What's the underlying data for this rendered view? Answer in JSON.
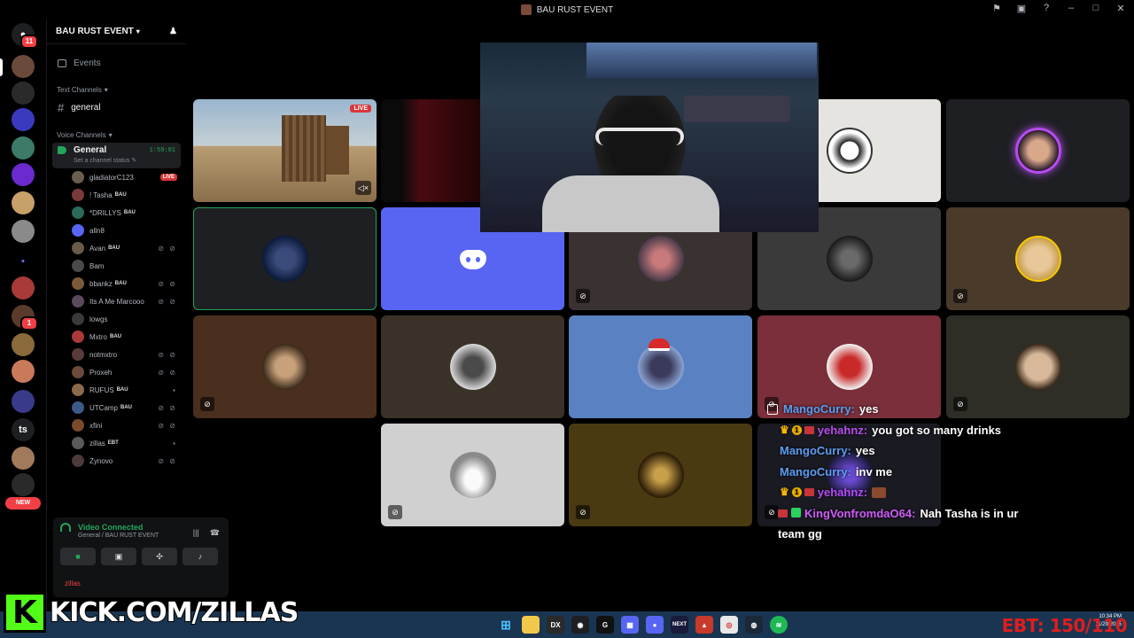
{
  "window": {
    "title": "BAU RUST EVENT"
  },
  "rail": {
    "mention_badge": "11",
    "dm_badge_1": "",
    "dm_badge_2": "1",
    "ts_label": "ts",
    "new_label": "NEW"
  },
  "server": {
    "name": "BAU RUST EVENT",
    "events_label": "Events",
    "text_category": "Text Channels",
    "text_channels": [
      {
        "name": "general"
      }
    ],
    "voice_category": "Voice Channels",
    "voice_channel": {
      "name": "General",
      "timer": "1:59:01",
      "status_placeholder": "Set a channel status"
    },
    "members": [
      {
        "name": "gladiatorC123",
        "tag": "",
        "live": "LIVE",
        "icons": "",
        "color": "#6b5e4e"
      },
      {
        "name": "! Tasha",
        "tag": "BAU",
        "live": "",
        "icons": "",
        "color": "#7a3a3a"
      },
      {
        "name": "*DRILLYS",
        "tag": "BAU",
        "live": "",
        "icons": "",
        "color": "#2a6a5a"
      },
      {
        "name": "alln8",
        "tag": "",
        "live": "",
        "icons": "",
        "color": "#5865f2"
      },
      {
        "name": "Avan",
        "tag": "BAU",
        "live": "",
        "icons": "⊘ ⊘",
        "color": "#6a5a4a"
      },
      {
        "name": "Bam",
        "tag": "",
        "live": "",
        "icons": "",
        "color": "#4a4a4a"
      },
      {
        "name": "bbankz",
        "tag": "BAU",
        "live": "",
        "icons": "⊘ ⊘",
        "color": "#7a5a3a"
      },
      {
        "name": "Its A Me Marcooo",
        "tag": "",
        "live": "",
        "icons": "⊘ ⊘",
        "color": "#5a4a5a"
      },
      {
        "name": "lowgs",
        "tag": "",
        "live": "",
        "icons": "",
        "color": "#3a3a3a"
      },
      {
        "name": "Mxtro",
        "tag": "BAU",
        "live": "",
        "icons": "",
        "color": "#aa3a3a"
      },
      {
        "name": "notmxtro",
        "tag": "",
        "live": "",
        "icons": "⊘ ⊘",
        "color": "#5a3a3a"
      },
      {
        "name": "Proxeh",
        "tag": "",
        "live": "",
        "icons": "⊘ ⊘",
        "color": "#6a4a3a"
      },
      {
        "name": "RUFUS",
        "tag": "BAU",
        "live": "",
        "icons": "▪",
        "color": "#8a6a4a"
      },
      {
        "name": "UTCamp",
        "tag": "BAU",
        "live": "",
        "icons": "⊘ ⊘",
        "color": "#3a5a8a"
      },
      {
        "name": "xfini",
        "tag": "",
        "live": "",
        "icons": "⊘ ⊘",
        "color": "#7a4a2a"
      },
      {
        "name": "zillas",
        "tag": "EBT",
        "live": "",
        "icons": "▪",
        "color": "#5a5a5a"
      },
      {
        "name": "Zynovo",
        "tag": "",
        "live": "",
        "icons": "⊘ ⊘",
        "color": "#4a3a3a"
      }
    ]
  },
  "voice_panel": {
    "status": "Video Connected",
    "location": "General / BAU RUST EVENT",
    "user_name": "zillas"
  },
  "stage": {
    "stream_badge": "LIVE"
  },
  "chat": [
    {
      "user": "MangoCurry:",
      "text": "yes"
    },
    {
      "user": "yehahnz:",
      "text": "you got so many drinks",
      "badge_num": "1"
    },
    {
      "user": "MangoCurry:",
      "text": "yes"
    },
    {
      "user": "MangoCurry:",
      "text": "inv me"
    },
    {
      "user": "yehahnz:",
      "text": "",
      "badge_num": "1"
    },
    {
      "user": "KingVonfromdaO64:",
      "text": "Nah Tasha is in ur team gg"
    }
  ],
  "stream": {
    "kick_letter": "K",
    "kick_url": "KICK.COM/ZILLAS",
    "ebt_label": "EBT:",
    "ebt_value": "150/110"
  },
  "taskbar": {
    "next_label": "NEXT",
    "clock_time": "10:34 PM",
    "clock_date": "11/29/2025"
  }
}
